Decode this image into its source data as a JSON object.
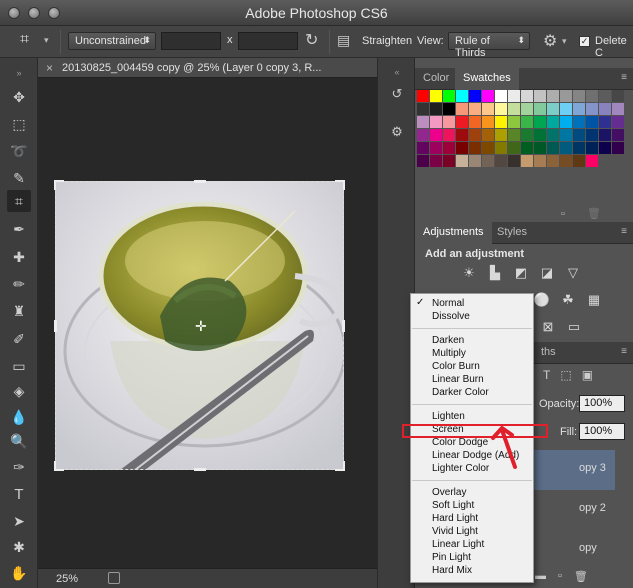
{
  "app": {
    "title": "Adobe Photoshop CS6"
  },
  "options_bar": {
    "ratio_label": "Unconstrained",
    "ratio_caret": "⬍",
    "times_sign": "x",
    "straighten_label": "Straighten",
    "view_label": "View:",
    "view_value": "Rule of Thirds",
    "delete_label": "Delete C"
  },
  "document": {
    "tab_title": "20130825_004459 copy @ 25% (Layer 0 copy 3, R...",
    "zoom": "25%"
  },
  "panels": {
    "color_tab": "Color",
    "swatches_tab": "Swatches",
    "adjustments_tab": "Adjustments",
    "styles_tab": "Styles",
    "add_adjustment": "Add an adjustment",
    "paths_tab_fragment": "ths",
    "opacity_label": "Opacity:",
    "opacity_value": "100%",
    "fill_label": "Fill:",
    "fill_value": "100%",
    "layer_names": [
      "opy 3",
      "opy 2",
      "opy"
    ]
  },
  "blend_menu": {
    "selected_check": "✓",
    "groups": [
      [
        "Normal",
        "Dissolve"
      ],
      [
        "Darken",
        "Multiply",
        "Color Burn",
        "Linear Burn",
        "Darker Color"
      ],
      [
        "Lighten",
        "Screen",
        "Color Dodge",
        "Linear Dodge (Add)",
        "Lighter Color"
      ],
      [
        "Overlay",
        "Soft Light",
        "Hard Light",
        "Vivid Light",
        "Linear Light",
        "Pin Light",
        "Hard Mix"
      ]
    ],
    "highlighted": "Screen"
  },
  "swatch_colors": [
    "#ff0000",
    "#ffff00",
    "#00ff00",
    "#00ffff",
    "#0000ff",
    "#ff00ff",
    "#ffffff",
    "#ebebeb",
    "#d6d6d6",
    "#c2c2c2",
    "#adadad",
    "#999999",
    "#858585",
    "#707070",
    "#5c5c5c",
    "#474747",
    "#333333",
    "#1f1f1f",
    "#000000",
    "#f7977a",
    "#f9ad81",
    "#fdc68a",
    "#fff79a",
    "#c4df9b",
    "#a2d39c",
    "#82ca9d",
    "#7bcdc8",
    "#6ecff6",
    "#7ea7d8",
    "#8493ca",
    "#8882be",
    "#a187be",
    "#bc8dbf",
    "#f49ac2",
    "#f6989d",
    "#ed1c24",
    "#f26522",
    "#f7941d",
    "#fff200",
    "#8dc63f",
    "#39b54a",
    "#00a651",
    "#00a99d",
    "#00aeef",
    "#0072bc",
    "#0054a6",
    "#2e3192",
    "#662d91",
    "#92278f",
    "#ec008c",
    "#ed145b",
    "#9e0b0f",
    "#a0410d",
    "#a36209",
    "#aba000",
    "#598527",
    "#1a7b30",
    "#007236",
    "#00746b",
    "#0076a3",
    "#004b80",
    "#003471",
    "#1b1464",
    "#440e62",
    "#630460",
    "#9e005d",
    "#9e0039",
    "#790000",
    "#7b2e00",
    "#7d4900",
    "#827b00",
    "#406618",
    "#005e20",
    "#005826",
    "#005952",
    "#005b7f",
    "#003663",
    "#002157",
    "#0d004c",
    "#32004b",
    "#4b0049",
    "#7b0046",
    "#7a0026",
    "#c7b299",
    "#998675",
    "#736357",
    "#534741",
    "#37302d",
    "#c69c6d",
    "#a67c52",
    "#8c6239",
    "#754c24",
    "#603913",
    "#ff0066"
  ]
}
